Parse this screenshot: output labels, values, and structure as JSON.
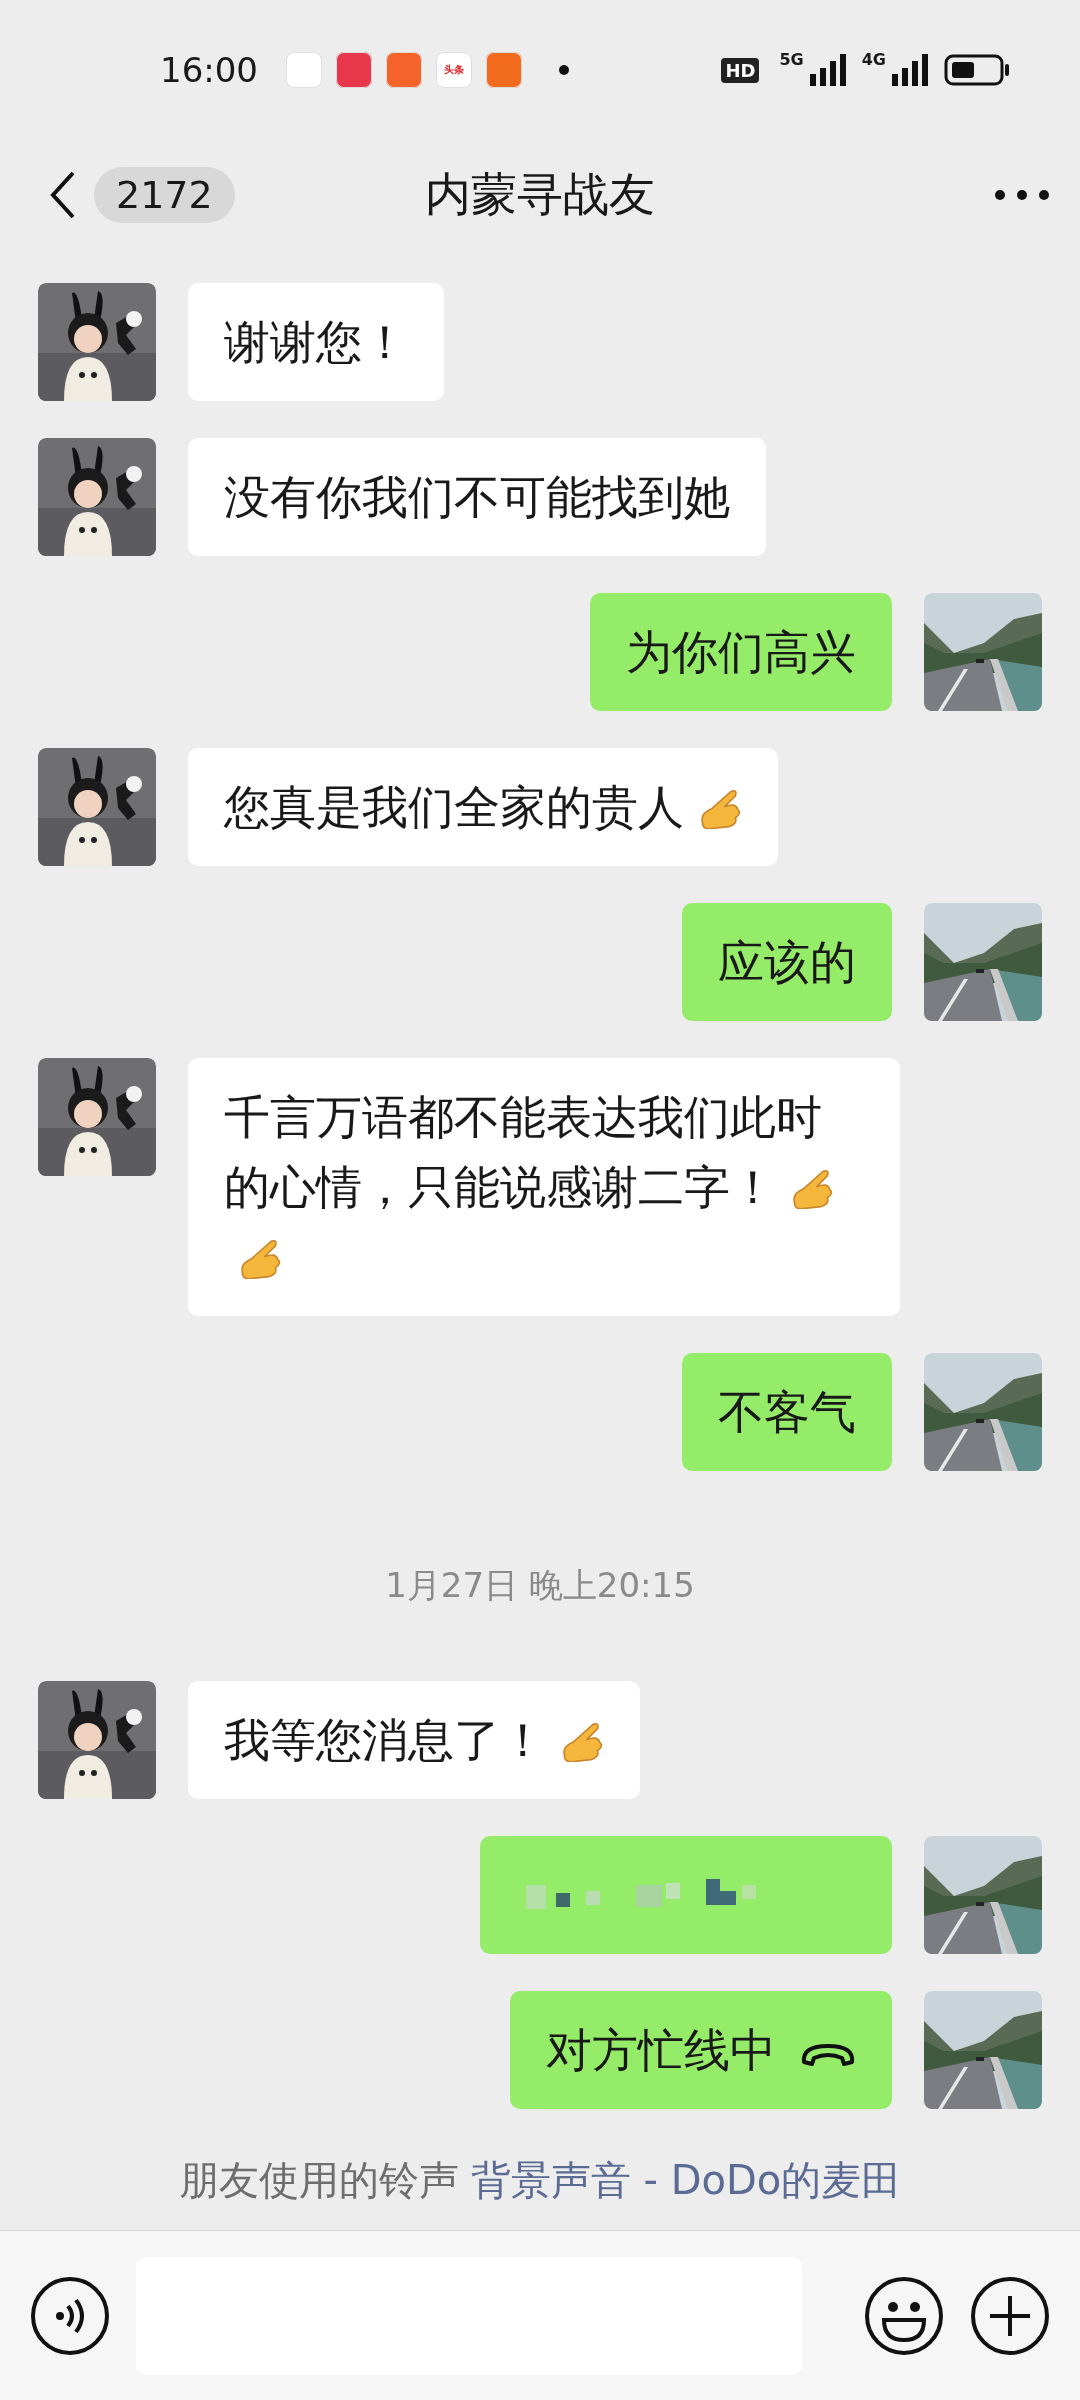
{
  "status_bar": {
    "time": "16:00",
    "apps": [
      {
        "color": "#ffffff"
      },
      {
        "color": "#e8364b"
      },
      {
        "color": "#f4642a"
      },
      {
        "color": "#ffffff",
        "label": "头条"
      },
      {
        "color": "#f26a1b"
      }
    ],
    "hd": "HD",
    "network_5g": "5G",
    "network_4g": "4G"
  },
  "header": {
    "unread": "2172",
    "title": "内蒙寻战友"
  },
  "messages": [
    {
      "kind": "text",
      "outgoing": false,
      "segments": [
        {
          "kind": "text",
          "text": "谢谢您！"
        }
      ]
    },
    {
      "kind": "text",
      "outgoing": false,
      "segments": [
        {
          "kind": "text",
          "text": "没有你我们不可能找到她"
        }
      ]
    },
    {
      "kind": "text",
      "outgoing": true,
      "segments": [
        {
          "kind": "text",
          "text": "为你们高兴"
        }
      ]
    },
    {
      "kind": "text",
      "outgoing": false,
      "segments": [
        {
          "kind": "text",
          "text": "您真是我们全家的贵人"
        },
        {
          "kind": "hand"
        }
      ]
    },
    {
      "kind": "text",
      "outgoing": true,
      "segments": [
        {
          "kind": "text",
          "text": "应该的"
        }
      ]
    },
    {
      "kind": "text",
      "outgoing": false,
      "segments": [
        {
          "kind": "text",
          "text": "千言万语都不能表达我们此时的心情，只能说感谢二字！"
        },
        {
          "kind": "hand"
        },
        {
          "kind": "hand"
        }
      ]
    },
    {
      "kind": "text",
      "outgoing": true,
      "segments": [
        {
          "kind": "text",
          "text": "不客气"
        }
      ]
    },
    {
      "kind": "time",
      "text": "1月27日 晚上20:15"
    },
    {
      "kind": "text",
      "outgoing": false,
      "segments": [
        {
          "kind": "text",
          "text": "我等您消息了！"
        },
        {
          "kind": "hand"
        }
      ]
    },
    {
      "kind": "blurred",
      "outgoing": true
    },
    {
      "kind": "call",
      "outgoing": true,
      "text": "对方忙线中"
    }
  ],
  "ringtone": {
    "label": "朋友使用的铃声",
    "link": "背景声音 - DoDo的麦田"
  }
}
